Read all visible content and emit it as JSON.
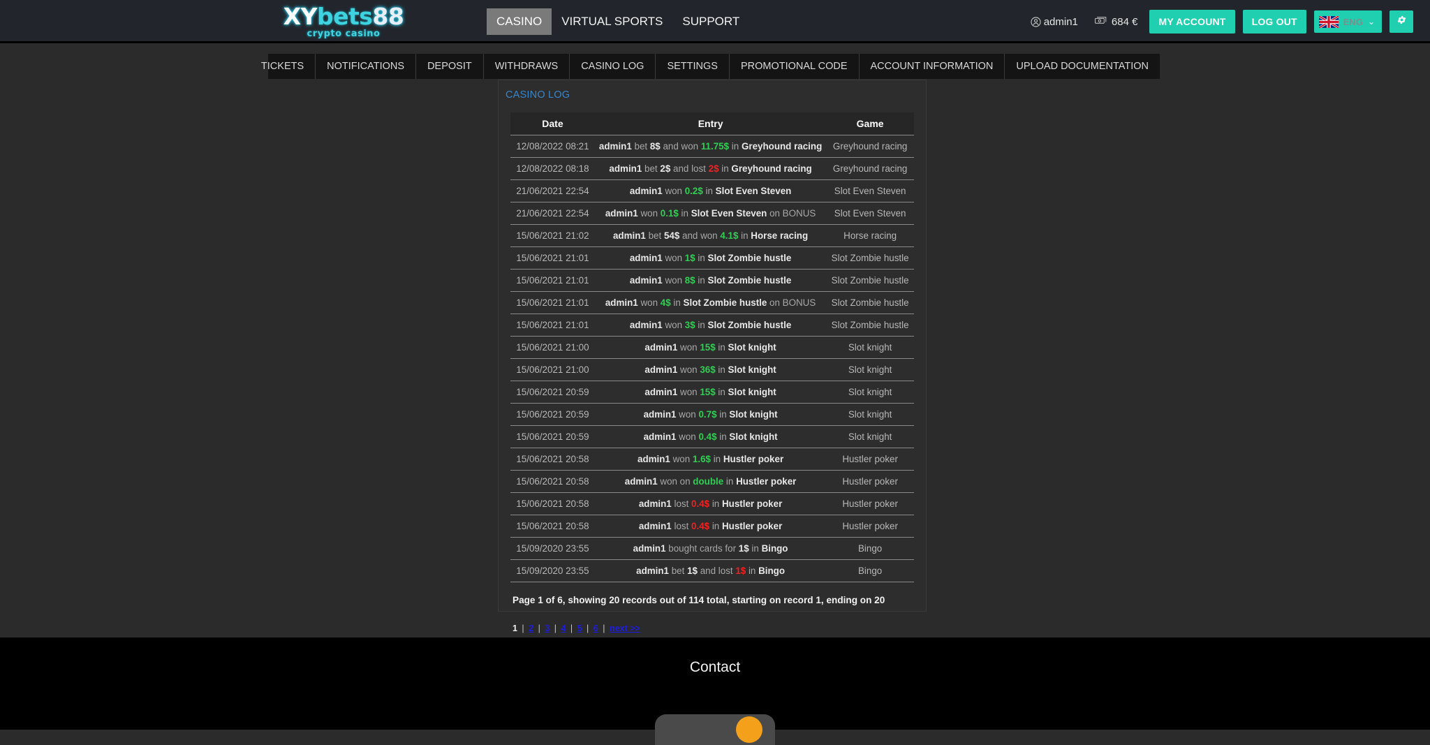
{
  "brand": {
    "logo_xy": "XY",
    "logo_bets": "bets",
    "logo_88": "88",
    "logo_sub": "crypto casino",
    "accent_teal": "#20cfb0",
    "accent_blue": "#3a86c8",
    "win_green": "#33cc55",
    "loss_red": "#ee2222"
  },
  "mainnav": {
    "items": [
      {
        "label": "CASINO",
        "active": true
      },
      {
        "label": "VIRTUAL SPORTS",
        "active": false
      },
      {
        "label": "SUPPORT",
        "active": false
      }
    ]
  },
  "userzone": {
    "username": "admin1",
    "balance": "684 €",
    "my_account": "MY ACCOUNT",
    "log_out": "LOG OUT",
    "language": "ENG",
    "caret": "⌄",
    "gear": "⚙"
  },
  "subnav": {
    "items": [
      "TICKETS",
      "NOTIFICATIONS",
      "DEPOSIT",
      "WITHDRAWS",
      "CASINO LOG",
      "SETTINGS",
      "PROMOTIONAL CODE",
      "ACCOUNT INFORMATION",
      "UPLOAD DOCUMENTATION"
    ]
  },
  "panel": {
    "title": "CASINO LOG",
    "columns": [
      "Date",
      "Entry",
      "Game"
    ],
    "summary": "Page 1 of 6, showing 20 records out of 114 total, starting on record 1, ending on 20",
    "rows": [
      {
        "date": "12/08/2022 08:21",
        "user": "admin1",
        "pre": " bet ",
        "betamt": "8$",
        "mid": " and won ",
        "amount": "11.75$",
        "kind": "win",
        "post": " in ",
        "game_bold": "Greyhound racing",
        "tail": "",
        "game": "Greyhound racing"
      },
      {
        "date": "12/08/2022 08:18",
        "user": "admin1",
        "pre": " bet ",
        "betamt": "2$",
        "mid": " and lost ",
        "amount": "2$",
        "kind": "loss",
        "post": " in ",
        "game_bold": "Greyhound racing",
        "tail": "",
        "game": "Greyhound racing"
      },
      {
        "date": "21/06/2021 22:54",
        "user": "admin1",
        "pre": " won ",
        "betamt": "",
        "mid": "",
        "amount": "0.2$",
        "kind": "win",
        "post": " in ",
        "game_bold": "Slot Even Steven",
        "tail": "",
        "game": "Slot Even Steven"
      },
      {
        "date": "21/06/2021 22:54",
        "user": "admin1",
        "pre": " won ",
        "betamt": "",
        "mid": "",
        "amount": "0.1$",
        "kind": "win",
        "post": " in ",
        "game_bold": "Slot Even Steven",
        "tail": " on BONUS",
        "game": "Slot Even Steven"
      },
      {
        "date": "15/06/2021 21:02",
        "user": "admin1",
        "pre": " bet ",
        "betamt": "54$",
        "mid": " and won ",
        "amount": "4.1$",
        "kind": "win",
        "post": " in ",
        "game_bold": "Horse racing",
        "tail": "",
        "game": "Horse racing"
      },
      {
        "date": "15/06/2021 21:01",
        "user": "admin1",
        "pre": " won ",
        "betamt": "",
        "mid": "",
        "amount": "1$",
        "kind": "win",
        "post": " in ",
        "game_bold": "Slot Zombie hustle",
        "tail": "",
        "game": "Slot Zombie hustle"
      },
      {
        "date": "15/06/2021 21:01",
        "user": "admin1",
        "pre": " won ",
        "betamt": "",
        "mid": "",
        "amount": "8$",
        "kind": "win",
        "post": " in ",
        "game_bold": "Slot Zombie hustle",
        "tail": "",
        "game": "Slot Zombie hustle"
      },
      {
        "date": "15/06/2021 21:01",
        "user": "admin1",
        "pre": " won ",
        "betamt": "",
        "mid": "",
        "amount": "4$",
        "kind": "win",
        "post": " in ",
        "game_bold": "Slot Zombie hustle",
        "tail": " on BONUS",
        "game": "Slot Zombie hustle"
      },
      {
        "date": "15/06/2021 21:01",
        "user": "admin1",
        "pre": " won ",
        "betamt": "",
        "mid": "",
        "amount": "3$",
        "kind": "win",
        "post": " in ",
        "game_bold": "Slot Zombie hustle",
        "tail": "",
        "game": "Slot Zombie hustle"
      },
      {
        "date": "15/06/2021 21:00",
        "user": "admin1",
        "pre": " won ",
        "betamt": "",
        "mid": "",
        "amount": "15$",
        "kind": "win",
        "post": " in ",
        "game_bold": "Slot knight",
        "tail": "",
        "game": "Slot knight"
      },
      {
        "date": "15/06/2021 21:00",
        "user": "admin1",
        "pre": " won ",
        "betamt": "",
        "mid": "",
        "amount": "36$",
        "kind": "win",
        "post": " in ",
        "game_bold": "Slot knight",
        "tail": "",
        "game": "Slot knight"
      },
      {
        "date": "15/06/2021 20:59",
        "user": "admin1",
        "pre": " won ",
        "betamt": "",
        "mid": "",
        "amount": "15$",
        "kind": "win",
        "post": " in ",
        "game_bold": "Slot knight",
        "tail": "",
        "game": "Slot knight"
      },
      {
        "date": "15/06/2021 20:59",
        "user": "admin1",
        "pre": " won ",
        "betamt": "",
        "mid": "",
        "amount": "0.7$",
        "kind": "win",
        "post": " in ",
        "game_bold": "Slot knight",
        "tail": "",
        "game": "Slot knight"
      },
      {
        "date": "15/06/2021 20:59",
        "user": "admin1",
        "pre": " won ",
        "betamt": "",
        "mid": "",
        "amount": "0.4$",
        "kind": "win",
        "post": " in ",
        "game_bold": "Slot knight",
        "tail": "",
        "game": "Slot knight"
      },
      {
        "date": "15/06/2021 20:58",
        "user": "admin1",
        "pre": " won ",
        "betamt": "",
        "mid": "",
        "amount": "1.6$",
        "kind": "win",
        "post": " in ",
        "game_bold": "Hustler poker",
        "tail": "",
        "game": "Hustler poker"
      },
      {
        "date": "15/06/2021 20:58",
        "user": "admin1",
        "pre": " won on ",
        "betamt": "",
        "mid": "",
        "amount": "double",
        "kind": "win",
        "post": " in ",
        "game_bold": "Hustler poker",
        "tail": "",
        "game": "Hustler poker"
      },
      {
        "date": "15/06/2021 20:58",
        "user": "admin1",
        "pre": " lost ",
        "betamt": "",
        "mid": "",
        "amount": "0.4$",
        "kind": "loss",
        "post": " in ",
        "game_bold": "Hustler poker",
        "tail": "",
        "game": "Hustler poker"
      },
      {
        "date": "15/06/2021 20:58",
        "user": "admin1",
        "pre": " lost ",
        "betamt": "",
        "mid": "",
        "amount": "0.4$",
        "kind": "loss",
        "post": " in ",
        "game_bold": "Hustler poker",
        "tail": "",
        "game": "Hustler poker"
      },
      {
        "date": "15/09/2020 23:55",
        "user": "admin1",
        "pre": " bought cards for ",
        "betamt": "1$",
        "mid": "",
        "amount": "",
        "kind": "none",
        "post": " in ",
        "game_bold": "Bingo",
        "tail": "",
        "game": "Bingo"
      },
      {
        "date": "15/09/2020 23:55",
        "user": "admin1",
        "pre": " bet ",
        "betamt": "1$",
        "mid": " and lost ",
        "amount": "1$",
        "kind": "loss",
        "post": " in ",
        "game_bold": "Bingo",
        "tail": "",
        "game": "Bingo"
      }
    ]
  },
  "pagination": {
    "current": "1",
    "pages": [
      "2",
      "3",
      "4",
      "5",
      "6"
    ],
    "next": "next >>",
    "separator": "|"
  },
  "footer": {
    "title": "Contact"
  }
}
